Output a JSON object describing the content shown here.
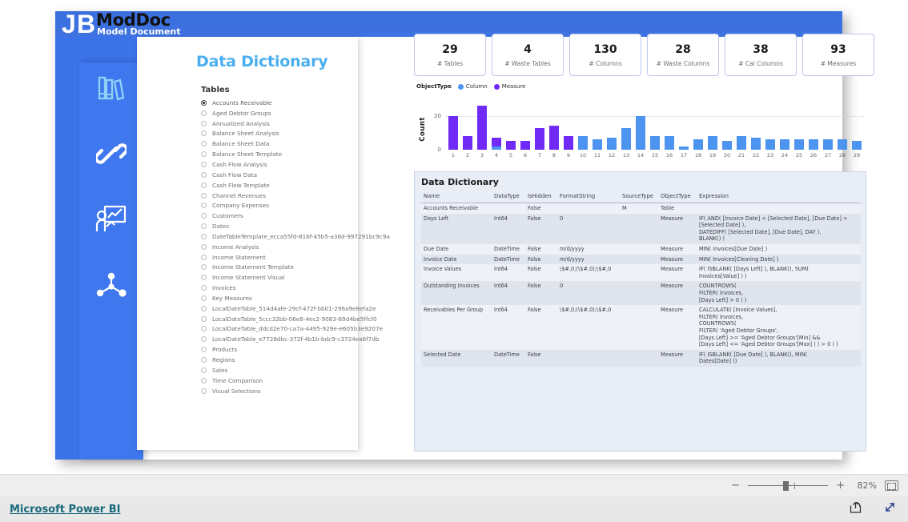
{
  "brand": {
    "logo_left": "J",
    "logo_right": "B",
    "title": "ModDoc",
    "subtitle": "Model Document"
  },
  "nav": {
    "items": [
      {
        "icon": "books-icon",
        "name": "nav-item-books"
      },
      {
        "icon": "link-icon",
        "name": "nav-item-relationships"
      },
      {
        "icon": "presentation-chart-icon",
        "name": "nav-item-visuals"
      },
      {
        "icon": "network-nodes-icon",
        "name": "nav-item-lineage"
      }
    ]
  },
  "page": {
    "title": "Data Dictionary"
  },
  "slicer": {
    "header": "Tables",
    "selected": "Accounts Receivable",
    "items": [
      "Accounts Receivable",
      "Aged Debtor Groups",
      "Annualized Analysis",
      "Balance Sheet Analysis",
      "Balance Sheet Data",
      "Balance Sheet Template",
      "Cash Flow Analysis",
      "Cash Flow Data",
      "Cash Flow Template",
      "Channel Revenues",
      "Company Expenses",
      "Customers",
      "Dates",
      "DateTableTemplate_ecca55fd-816f-45b5-a36d-997291bc9c9a",
      "Income Analysis",
      "Income Statement",
      "Income Statement Template",
      "Income Statement Visual",
      "Invoices",
      "Key Measures",
      "LocalDateTable_514d4afe-29cf-472f-bb01-296a9e8efa2e",
      "LocalDateTable_5ccc32bb-06e8-4ec2-9083-69d4be5ffcf0",
      "LocalDateTable_ddcd2e70-ca7a-4495-929e-e605b3e9207e",
      "LocalDateTable_e7728dbc-372f-4b1b-bdc9-c3724ea6f7db",
      "Products",
      "Regions",
      "Sales",
      "Time Comparison",
      "Visual Selections"
    ]
  },
  "kpis": [
    {
      "value": "29",
      "label": "# Tables"
    },
    {
      "value": "4",
      "label": "# Waste Tables"
    },
    {
      "value": "130",
      "label": "# Columns"
    },
    {
      "value": "28",
      "label": "# Waste Columns"
    },
    {
      "value": "38",
      "label": "# Cal Columns"
    },
    {
      "value": "93",
      "label": "# Measures"
    }
  ],
  "chart_data": {
    "type": "bar",
    "title": "",
    "legend_title": "ObjectType",
    "legend_position": "top-left",
    "xlabel": "",
    "ylabel": "Count",
    "ylim": [
      0,
      26
    ],
    "yticks": [
      "0",
      "20"
    ],
    "grid": true,
    "stacked": true,
    "categories": [
      "1",
      "2",
      "3",
      "4",
      "5",
      "6",
      "7",
      "8",
      "9",
      "10",
      "11",
      "12",
      "13",
      "14",
      "15",
      "16",
      "17",
      "18",
      "19",
      "20",
      "21",
      "22",
      "23",
      "24",
      "25",
      "26",
      "27",
      "28",
      "29"
    ],
    "series": [
      {
        "name": "Column",
        "color": "#4d94f0",
        "values": [
          0,
          0,
          0,
          2,
          0,
          0,
          0,
          0,
          0,
          8,
          6,
          7,
          13,
          20,
          8,
          8,
          2,
          6,
          8,
          5,
          8,
          7,
          6,
          6,
          6,
          6,
          6,
          6,
          5
        ]
      },
      {
        "name": "Measure",
        "color": "#6f2bf5",
        "values": [
          20,
          8,
          26,
          5,
          5,
          5,
          13,
          14,
          8,
          0,
          0,
          0,
          0,
          0,
          0,
          0,
          0,
          0,
          0,
          0,
          0,
          0,
          0,
          0,
          0,
          0,
          0,
          0,
          0
        ]
      }
    ]
  },
  "table_visual": {
    "title": "Data Dictionary",
    "columns": [
      "Name",
      "DataType",
      "IsHidden",
      "FormatString",
      "SourceType",
      "ObjectType",
      "Expression"
    ],
    "rows": [
      {
        "name": "Accounts Receivable",
        "datatype": "",
        "ishidden": "False",
        "formatstring": "",
        "sourcetype": "M",
        "objecttype": "Table",
        "expression": ""
      },
      {
        "name": "Days Left",
        "datatype": "Int64",
        "ishidden": "False",
        "formatstring": "0",
        "sourcetype": "",
        "objecttype": "Measure",
        "expression": "IF( AND( [Invoice Date] < [Selected Date], [Due Date] > [Selected Date] ),\nDATEDIFF( [Selected Date], [Due Date], DAY ),\nBLANK() )"
      },
      {
        "name": "Due Date",
        "datatype": "DateTime",
        "ishidden": "False",
        "formatstring": "m/d/yyyy",
        "sourcetype": "",
        "objecttype": "Measure",
        "expression": "MIN( Invoices[Due Date] )"
      },
      {
        "name": "Invoice Date",
        "datatype": "DateTime",
        "ishidden": "False",
        "formatstring": "m/d/yyyy",
        "sourcetype": "",
        "objecttype": "Measure",
        "expression": "MIN( Invoices[Clearing Date] )"
      },
      {
        "name": "Invoice Values",
        "datatype": "Int64",
        "ishidden": "False",
        "formatstring": "\\$#,0;(\\$#,0);\\$#,0",
        "sourcetype": "",
        "objecttype": "Measure",
        "expression": "IF( ISBLANK( [Days Left] ), BLANK(), SUM(\nInvoices[Value] ) )"
      },
      {
        "name": "Outstanding Invoices",
        "datatype": "Int64",
        "ishidden": "False",
        "formatstring": "0",
        "sourcetype": "",
        "objecttype": "Measure",
        "expression": "COUNTROWS(\nFILTER( Invoices,\n[Days Left] > 0 ) )"
      },
      {
        "name": "Receivables Per Group",
        "datatype": "Int64",
        "ishidden": "False",
        "formatstring": "\\$#,0;(\\$#,0);\\$#,0",
        "sourcetype": "",
        "objecttype": "Measure",
        "expression": "CALCULATE( [Invoice Values],\nFILTER( Invoices,\nCOUNTROWS(\nFILTER( 'Aged Debtor Groups',\n[Days Left] >= 'Aged Debtor Groups'[Min] &&\n[Days Left] <= 'Aged Debtor Groups'[Max] ) ) > 0 ) )"
      },
      {
        "name": "Selected Date",
        "datatype": "DateTime",
        "ishidden": "False",
        "formatstring": "",
        "sourcetype": "",
        "objecttype": "Measure",
        "expression": "IF( ISBLANK( [Due Date] ), BLANK(), MIN(\nDates[Date] ))"
      }
    ]
  },
  "zoom_bar": {
    "minus": "−",
    "plus": "+",
    "percent": "82%",
    "fit_icon": "fit-to-page-icon"
  },
  "footer": {
    "link": "Microsoft Power BI",
    "share_icon": "share-icon",
    "fullscreen_icon": "fullscreen-icon"
  },
  "colors": {
    "brand_blue": "#3a72e8",
    "title_blue": "#4aaff0",
    "measure_purple": "#6f2bf5",
    "column_blue": "#4d94f0",
    "footer_link": "#18697a"
  }
}
